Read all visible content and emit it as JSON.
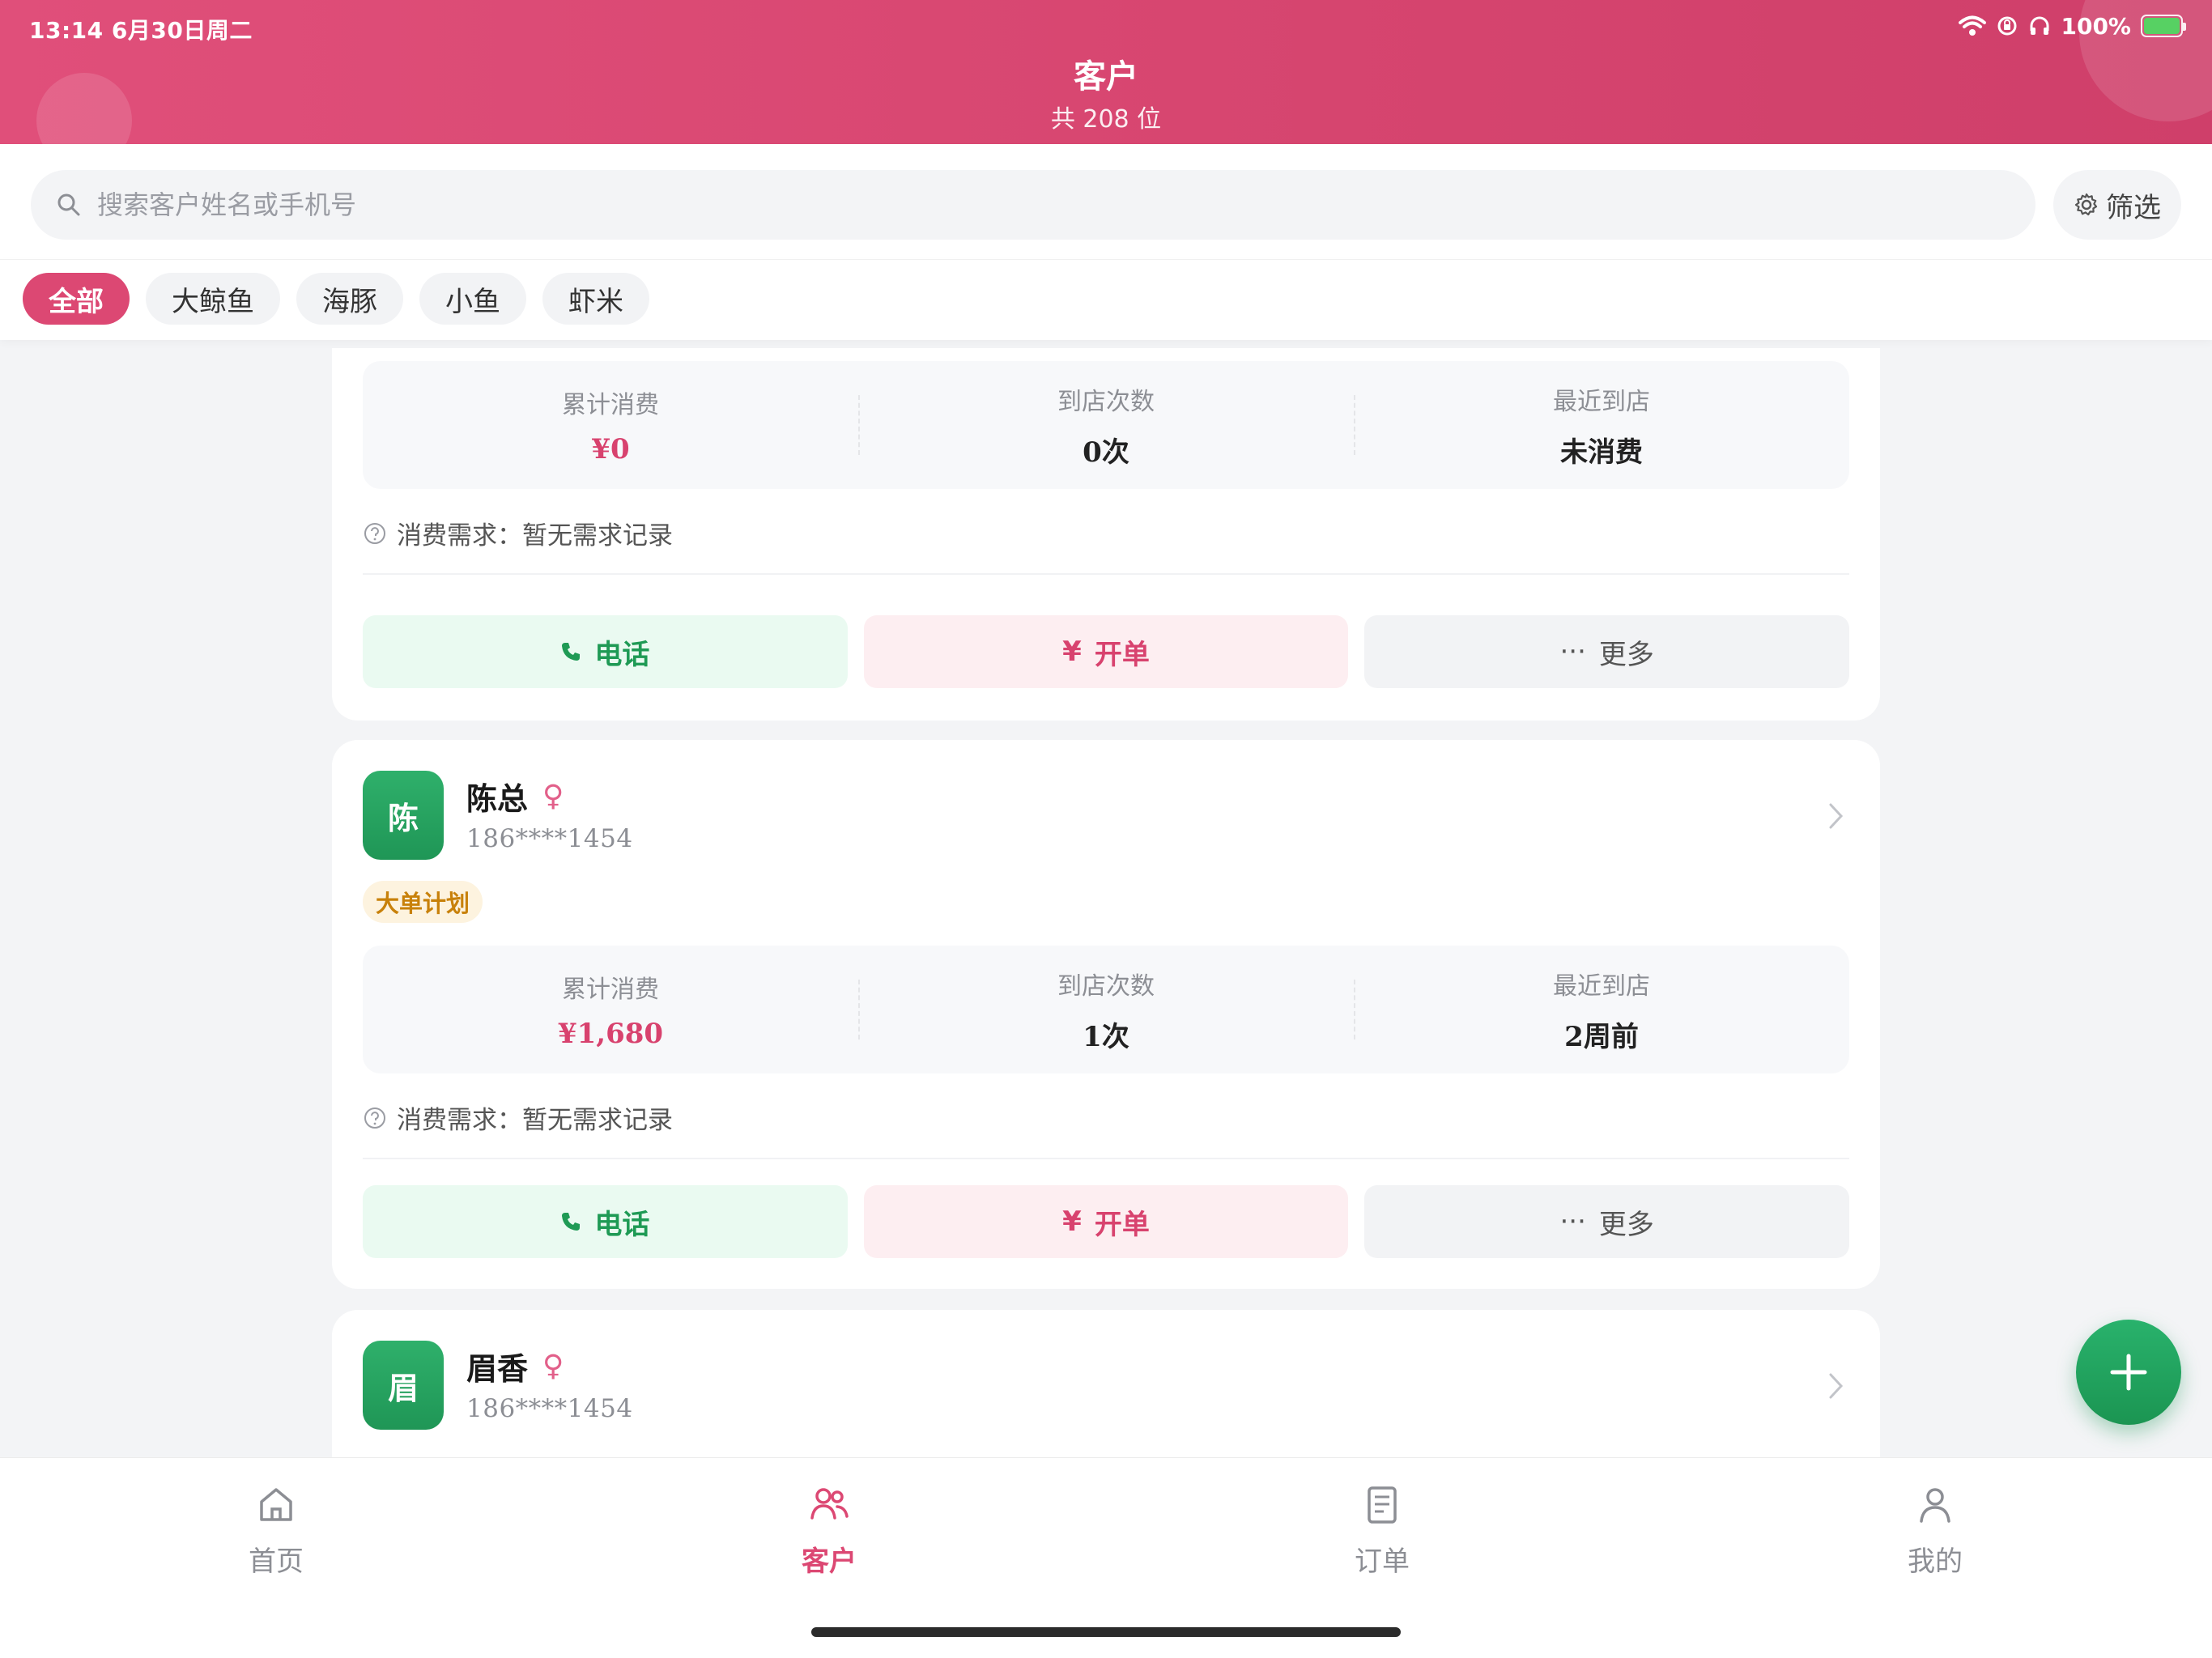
{
  "status_bar": {
    "time_date": "13:14   6月30日周二",
    "battery": "100%"
  },
  "header": {
    "title": "客户",
    "subtitle": "共 208 位"
  },
  "search": {
    "placeholder": "搜索客户姓名或手机号",
    "filter_label": "筛选"
  },
  "tabs": [
    {
      "label": "全部",
      "active": true
    },
    {
      "label": "大鲸鱼",
      "active": false
    },
    {
      "label": "海豚",
      "active": false
    },
    {
      "label": "小鱼",
      "active": false
    },
    {
      "label": "虾米",
      "active": false
    }
  ],
  "customers": [
    {
      "stats": [
        {
          "label": "累计消费",
          "value": "¥0"
        },
        {
          "label": "到店次数",
          "value": "0次"
        },
        {
          "label": "最近到店",
          "value": "未消费"
        }
      ],
      "need": "消费需求：暂无需求记录",
      "actions": {
        "call": "电话",
        "order": "开单",
        "more": "更多"
      }
    },
    {
      "avatar": "陈",
      "name": "陈总",
      "gender": "♀",
      "phone": "186****1454",
      "tag": "大单计划",
      "stats": [
        {
          "label": "累计消费",
          "value": "¥1,680"
        },
        {
          "label": "到店次数",
          "value": "1次"
        },
        {
          "label": "最近到店",
          "value": "2周前"
        }
      ],
      "need": "消费需求：暂无需求记录",
      "actions": {
        "call": "电话",
        "order": "开单",
        "more": "更多"
      }
    },
    {
      "avatar": "眉",
      "name": "眉香",
      "gender": "♀",
      "phone": "186****1454"
    }
  ],
  "bottom_nav": [
    {
      "label": "首页",
      "icon": "home-icon",
      "active": false
    },
    {
      "label": "客户",
      "icon": "customers-icon",
      "active": true
    },
    {
      "label": "订单",
      "icon": "order-icon",
      "active": false
    },
    {
      "label": "我的",
      "icon": "profile-icon",
      "active": false
    }
  ],
  "colors": {
    "brand": "#dc4873",
    "green": "#1f9a55",
    "tag_bg": "#fdf3df",
    "tag_text": "#c8810a"
  }
}
